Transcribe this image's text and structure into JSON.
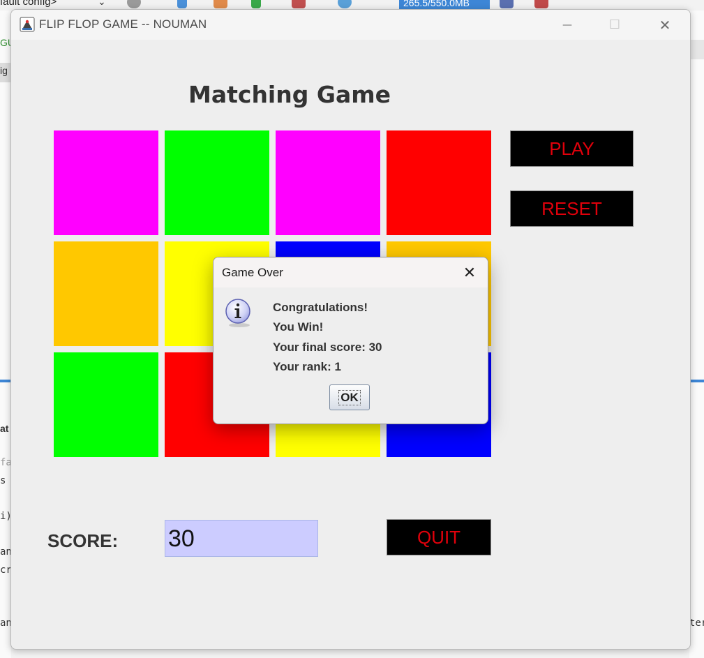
{
  "background_ide": {
    "run_config": "fault config>",
    "memory": "265.5/550.0MB",
    "fragments": [
      "GU",
      "ig",
      "at",
      "fa",
      "s",
      "i)",
      "an",
      "cr",
      "an",
      "ter"
    ]
  },
  "window": {
    "title": "FLIP FLOP GAME -- NOUMAN",
    "minimize_glyph": "—",
    "maximize_glyph": "☐",
    "close_glyph": "✕"
  },
  "game": {
    "title": "Matching Game",
    "tiles": [
      {
        "color": "#ff00ff"
      },
      {
        "color": "#00ff00"
      },
      {
        "color": "#ff00ff"
      },
      {
        "color": "#ff0000"
      },
      {
        "color": "#ffc800"
      },
      {
        "color": "#ffff00"
      },
      {
        "color": "#0000ff"
      },
      {
        "color": "#ffc800"
      },
      {
        "color": "#00ff00"
      },
      {
        "color": "#ff0000"
      },
      {
        "color": "#ffff00"
      },
      {
        "color": "#0000ff"
      }
    ],
    "buttons": {
      "play": "PLAY",
      "reset": "RESET",
      "quit": "QUIT"
    },
    "score_label": "SCORE:",
    "score_value": "30",
    "colors": {
      "button_bg": "#000000",
      "button_text": "#e0000b",
      "score_field_bg": "#ccccff"
    }
  },
  "dialog": {
    "title": "Game Over",
    "close_glyph": "✕",
    "icon": "info-icon",
    "lines": [
      "Congratulations!",
      "You Win!",
      "Your final score: 30",
      "Your rank: 1"
    ],
    "ok_label": "OK"
  }
}
